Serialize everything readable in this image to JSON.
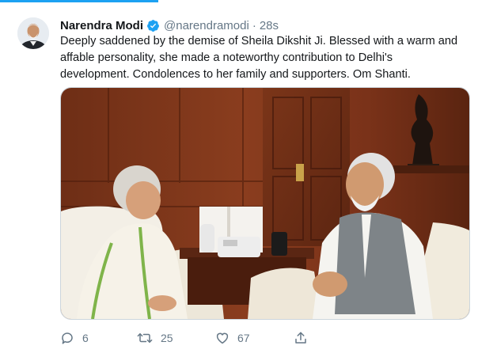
{
  "tweet": {
    "author_name": "Narendra Modi",
    "handle": "@narendramodi",
    "separator": "·",
    "timestamp": "28s",
    "text_lines": [
      "Deeply saddened by the demise of Sheila Dikshit Ji. Blessed with a warm and",
      "affable personality, she made a noteworthy contribution to Delhi's",
      "development. Condolences to her family and supporters. Om Shanti."
    ],
    "verified_icon": "verified-badge-icon",
    "accent_color": "#1da1f2",
    "photo_description_icon": "photo"
  },
  "actions": {
    "reply_count": "6",
    "retweet_count": "25",
    "like_count": "67",
    "icons": [
      "reply-icon",
      "retweet-icon",
      "like-icon",
      "share-icon"
    ]
  }
}
